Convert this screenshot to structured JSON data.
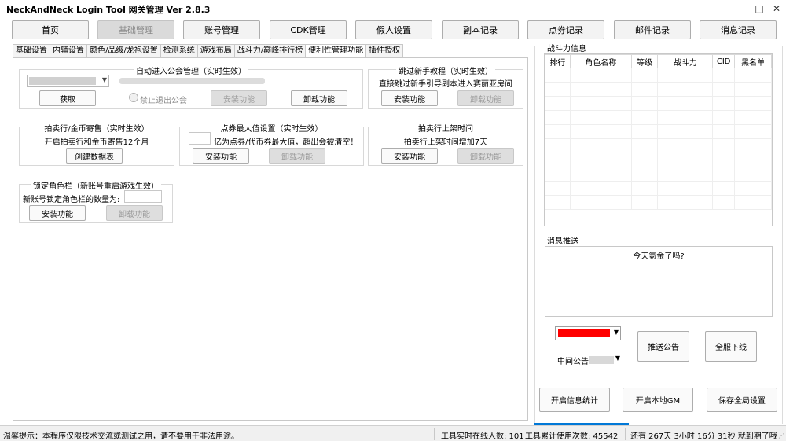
{
  "window": {
    "title": "NeckAndNeck Login Tool 网关管理 Ver 2.8.3",
    "minimize_glyph": "—",
    "maximize_glyph": "□",
    "close_glyph": "✕"
  },
  "top_buttons": {
    "home": "首页",
    "basic": "基础管理",
    "account": "账号管理",
    "cdk": "CDK管理",
    "fake": "假人设置",
    "dungeon": "副本记录",
    "points": "点券记录",
    "mail": "邮件记录",
    "message": "消息记录"
  },
  "tabs": [
    "基础设置",
    "内辅设置",
    "颜色/品级/龙袍设置",
    "检测系统",
    "游戏布局",
    "战斗力/巅峰排行榜",
    "便利性管理功能",
    "插件授权"
  ],
  "groups": {
    "guild": {
      "title": "自动进入公会管理（实时生效）",
      "get_btn": "获取",
      "radio_label": "禁止退出公会",
      "install_btn": "安装功能",
      "uninstall_btn": "卸载功能"
    },
    "tutorial": {
      "title": "跳过新手教程（实时生效）",
      "line": "直接跳过新手引导副本进入赛丽亚房间",
      "install_btn": "安装功能",
      "uninstall_btn": "卸载功能"
    },
    "auction": {
      "title": "拍卖行/金币寄售（实时生效）",
      "line": "开启拍卖行和金币寄售12个月",
      "create_btn": "创建数据表"
    },
    "coupon": {
      "title": "点券最大值设置（实时生效）",
      "line": "亿为点券/代币券最大值，超出会被清空！",
      "install_btn": "安装功能",
      "uninstall_btn": "卸载功能"
    },
    "auction_time": {
      "title": "拍卖行上架时间",
      "line": "拍卖行上架时间增加7天",
      "install_btn": "安装功能",
      "uninstall_btn": "卸载功能"
    },
    "char_slot": {
      "title": "锁定角色栏（新账号重启游戏生效）",
      "line": "新账号锁定角色栏的数量为:",
      "install_btn": "安装功能",
      "uninstall_btn": "卸载功能"
    }
  },
  "power_info": {
    "title": "战斗力信息",
    "columns": [
      "排行",
      "角色名称",
      "等级",
      "战斗力",
      "CID",
      "黑名单"
    ]
  },
  "message_push": {
    "title": "消息推送",
    "content": "今天氪金了吗?",
    "color": "#ff0000",
    "type_selected": "中间公告",
    "push_btn": "推送公告",
    "offline_btn": "全服下线"
  },
  "bottom_buttons": {
    "stats": "开启信息统计",
    "local_gm": "开启本地GM",
    "save": "保存全局设置"
  },
  "status": {
    "notice": "温馨提示：本程序仅限技术交流或测试之用，请不要用于非法用途。",
    "online": "工具实时在线人数: 101",
    "usage": "工具累计使用次数: 45542",
    "remaining": "还有 267天 3小时 16分 31秒 就到期了哦"
  },
  "colors": {
    "accent": "#0078d7",
    "push_color": "#ff0000"
  }
}
